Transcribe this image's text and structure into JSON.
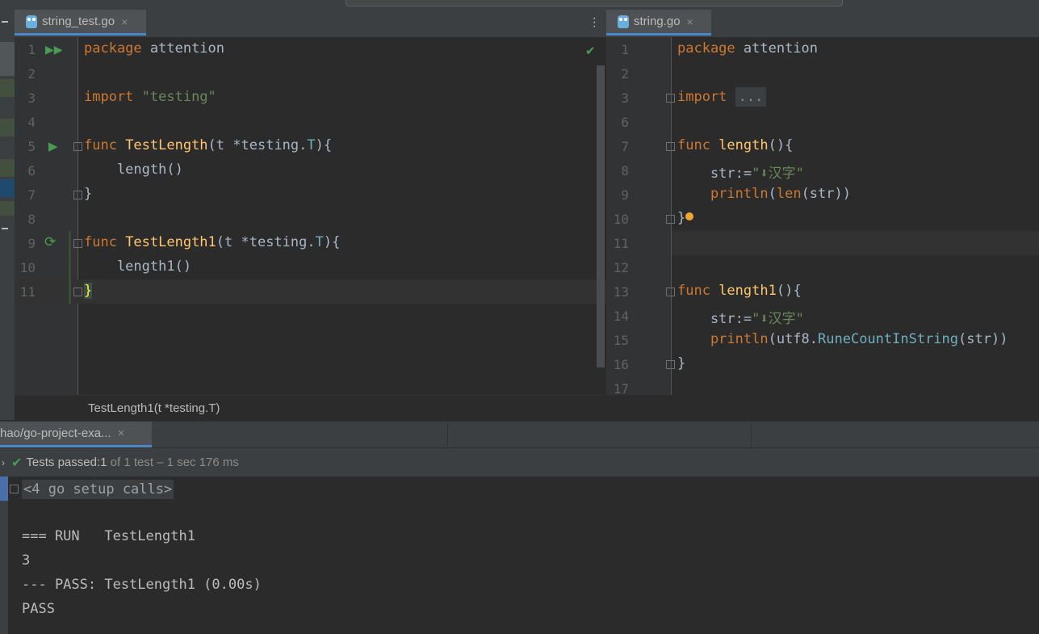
{
  "left_editor": {
    "tab": {
      "name": "string_test.go",
      "close": "×"
    },
    "lines": [
      {
        "n": "1",
        "tokens": [
          [
            "kw",
            "package "
          ],
          [
            "pl",
            "attention"
          ]
        ]
      },
      {
        "n": "2",
        "tokens": []
      },
      {
        "n": "3",
        "tokens": [
          [
            "kw",
            "import "
          ],
          [
            "str",
            "\"testing\""
          ]
        ]
      },
      {
        "n": "4",
        "tokens": []
      },
      {
        "n": "5",
        "tokens": [
          [
            "kw",
            "func "
          ],
          [
            "fn",
            "TestLength"
          ],
          [
            "pl",
            "(t *"
          ],
          [
            "pl",
            "testing."
          ],
          [
            "typ",
            "T"
          ],
          [
            "pl",
            "){"
          ]
        ]
      },
      {
        "n": "6",
        "tokens": [
          [
            "pl",
            "    length()"
          ]
        ]
      },
      {
        "n": "7",
        "tokens": [
          [
            "pl",
            "}"
          ]
        ]
      },
      {
        "n": "8",
        "tokens": []
      },
      {
        "n": "9",
        "tokens": [
          [
            "kw",
            "func "
          ],
          [
            "fn",
            "TestLength1"
          ],
          [
            "pl",
            "(t *"
          ],
          [
            "pl",
            "testing."
          ],
          [
            "typ",
            "T"
          ],
          [
            "pl",
            "){"
          ]
        ]
      },
      {
        "n": "10",
        "tokens": [
          [
            "pl",
            "    length1()"
          ]
        ]
      },
      {
        "n": "11",
        "tokens": [
          [
            "pl",
            "}"
          ]
        ]
      }
    ],
    "breadcrumb": "TestLength1(t *testing.T)"
  },
  "right_editor": {
    "tab": {
      "name": "string.go",
      "close": "×"
    },
    "lines": [
      {
        "n": "1",
        "tokens": [
          [
            "kw",
            "package "
          ],
          [
            "pl",
            "attention"
          ]
        ]
      },
      {
        "n": "2",
        "tokens": []
      },
      {
        "n": "3",
        "tokens": [
          [
            "kw",
            "import "
          ],
          [
            "pl",
            "..."
          ]
        ]
      },
      {
        "n": "6",
        "tokens": []
      },
      {
        "n": "7",
        "tokens": [
          [
            "kw",
            "func "
          ],
          [
            "fn",
            "length"
          ],
          [
            "pl",
            "(){"
          ]
        ]
      },
      {
        "n": "8",
        "tokens": [
          [
            "pl",
            "    str:="
          ],
          [
            "str",
            "\"⬇汉字\""
          ]
        ]
      },
      {
        "n": "9",
        "tokens": [
          [
            "bi",
            "    println"
          ],
          [
            "pl",
            "("
          ],
          [
            "bi",
            "len"
          ],
          [
            "pl",
            "(str))"
          ]
        ]
      },
      {
        "n": "10",
        "tokens": [
          [
            "pl",
            "}"
          ]
        ]
      },
      {
        "n": "11",
        "tokens": []
      },
      {
        "n": "12",
        "tokens": []
      },
      {
        "n": "13",
        "tokens": [
          [
            "kw",
            "func "
          ],
          [
            "fn",
            "length1"
          ],
          [
            "pl",
            "(){"
          ]
        ]
      },
      {
        "n": "14",
        "tokens": [
          [
            "pl",
            "    str:="
          ],
          [
            "str",
            "\"⬇汉字\""
          ]
        ]
      },
      {
        "n": "15",
        "tokens": [
          [
            "bi",
            "    println"
          ],
          [
            "pl",
            "(utf8."
          ],
          [
            "typ",
            "RuneCountInString"
          ],
          [
            "pl",
            "(str))"
          ]
        ]
      },
      {
        "n": "16",
        "tokens": [
          [
            "pl",
            "}"
          ]
        ]
      },
      {
        "n": "17",
        "tokens": []
      }
    ]
  },
  "run_panel": {
    "tab_label": "hao/go-project-exa...",
    "tab_close": "×",
    "status": {
      "prefix": "Tests passed: ",
      "count": "1",
      "suffix": " of 1 test – 1 sec 176 ms"
    },
    "console_lines": [
      "<4 go setup calls>",
      "",
      "=== RUN   TestLength1",
      "3",
      "--- PASS: TestLength1 (0.00s)",
      "PASS"
    ]
  },
  "colors": {
    "keyword": "#cc7832",
    "string": "#6a8759",
    "function": "#ffc66d",
    "accent": "#4a88c7",
    "pass": "#499c54"
  }
}
